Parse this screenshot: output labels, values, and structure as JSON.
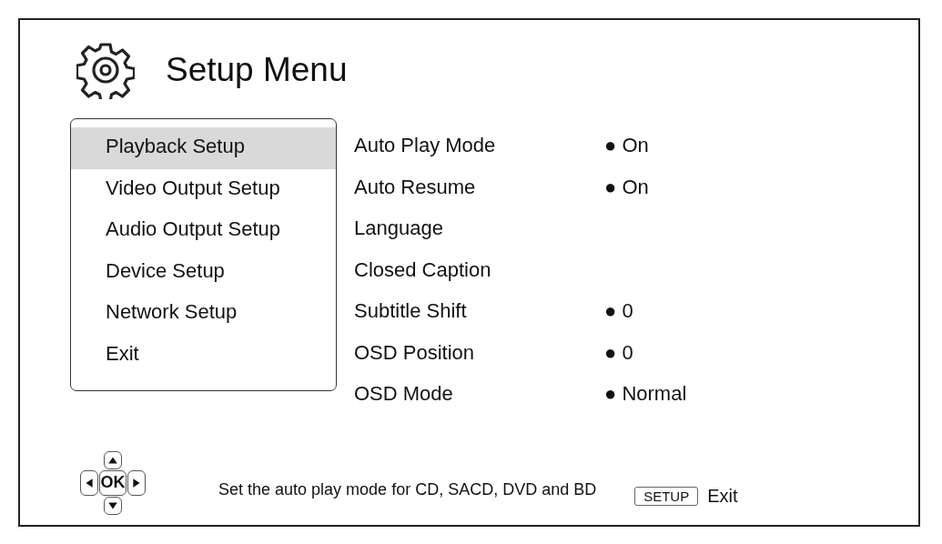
{
  "title": "Setup Menu",
  "menu": [
    {
      "label": "Playback Setup",
      "selected": true
    },
    {
      "label": "Video Output Setup",
      "selected": false
    },
    {
      "label": "Audio Output Setup",
      "selected": false
    },
    {
      "label": "Device Setup",
      "selected": false
    },
    {
      "label": "Network Setup",
      "selected": false
    },
    {
      "label": "Exit",
      "selected": false
    }
  ],
  "settings": [
    {
      "label": "Auto Play Mode",
      "value": "● On"
    },
    {
      "label": "Auto Resume",
      "value": "● On"
    },
    {
      "label": "Language"
    },
    {
      "label": "Closed Caption"
    },
    {
      "label": "Subtitle Shift",
      "value": "● 0"
    },
    {
      "label": "OSD Position",
      "value": "● 0"
    },
    {
      "label": "OSD Mode",
      "value": "● Normal"
    }
  ],
  "dpad": {
    "center": "OK"
  },
  "hint": "Set the auto play mode for CD, SACD, DVD and BD",
  "exit_key": {
    "key": "SETUP",
    "label": "Exit"
  }
}
